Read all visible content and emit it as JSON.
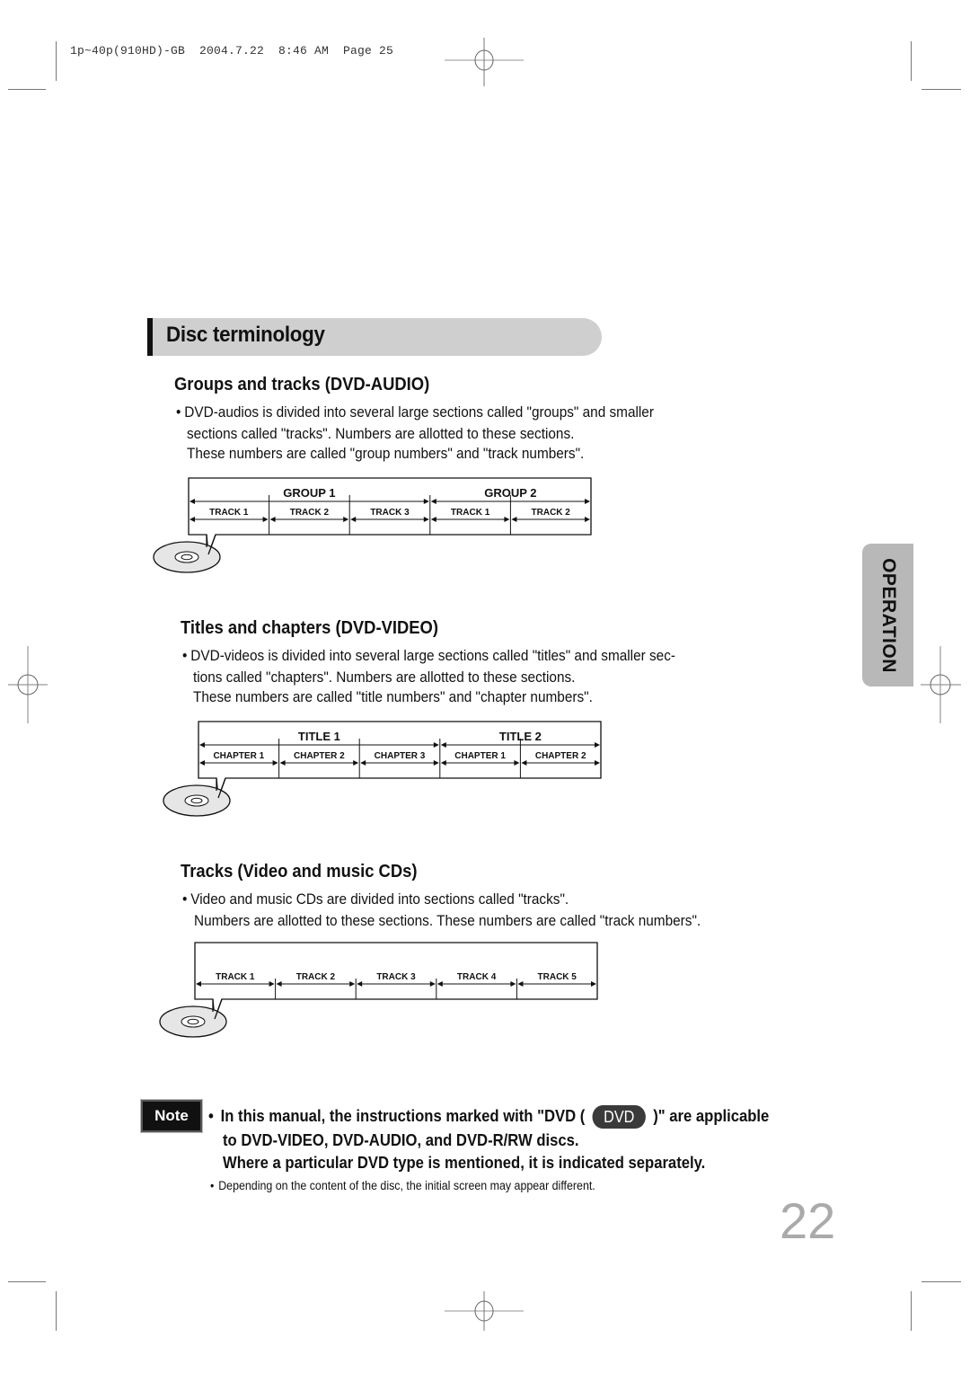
{
  "print_header": "1p~40p(910HD)-GB  2004.7.22  8:46 AM  Page 25",
  "section": {
    "title": "Disc terminology"
  },
  "side_tab": {
    "label": "OPERATION"
  },
  "groups_tracks": {
    "heading": "Groups and tracks (DVD-AUDIO)",
    "bullet_line1": "DVD-audios is divided into several large sections called \"groups\" and smaller",
    "bullet_line2": "sections called \"tracks\". Numbers are allotted to these sections.",
    "line3": "These numbers are called \"group numbers\" and \"track numbers\".",
    "diagram": {
      "top_labels": [
        "GROUP 1",
        "GROUP 2"
      ],
      "bottom_labels": [
        "TRACK 1",
        "TRACK 2",
        "TRACK 3",
        "TRACK 1",
        "TRACK 2"
      ],
      "top_spans": [
        3,
        2
      ]
    }
  },
  "titles_chapters": {
    "heading": "Titles and chapters (DVD-VIDEO)",
    "bullet_line1": "DVD-videos is divided into several large sections called \"titles\" and smaller sec-",
    "bullet_line2": "tions called \"chapters\". Numbers are allotted to these sections.",
    "line3": "These numbers are called \"title numbers\" and \"chapter numbers\".",
    "diagram": {
      "top_labels": [
        "TITLE 1",
        "TITLE 2"
      ],
      "bottom_labels": [
        "CHAPTER 1",
        "CHAPTER 2",
        "CHAPTER 3",
        "CHAPTER 1",
        "CHAPTER 2"
      ],
      "top_spans": [
        3,
        2
      ]
    }
  },
  "tracks_cds": {
    "heading": "Tracks (Video and music CDs)",
    "bullet_line1": "Video and music CDs are divided into sections called \"tracks\".",
    "line2": "Numbers are allotted to these sections. These numbers are called \"track numbers\".",
    "diagram": {
      "top_labels": [],
      "bottom_labels": [
        "TRACK 1",
        "TRACK 2",
        "TRACK 3",
        "TRACK 4",
        "TRACK 5"
      ],
      "top_spans": []
    }
  },
  "note": {
    "badge": "Note",
    "line1_before": "In this manual, the instructions marked with \"DVD (",
    "dvd_icon_label": "DVD",
    "line1_after": ")\" are applicable",
    "line2": "to DVD-VIDEO, DVD-AUDIO, and DVD-R/RW discs.",
    "line3": "Where a particular DVD type is mentioned, it is indicated separately.",
    "small": "Depending on the content of the disc, the initial screen may appear different."
  },
  "page_number": "22",
  "colors": {
    "banner_bg": "#cfcfcf",
    "side_tab_bg": "#b8b8b8",
    "page_number": "#aaaaaa",
    "dvd_pill": "#3a3a3a"
  }
}
